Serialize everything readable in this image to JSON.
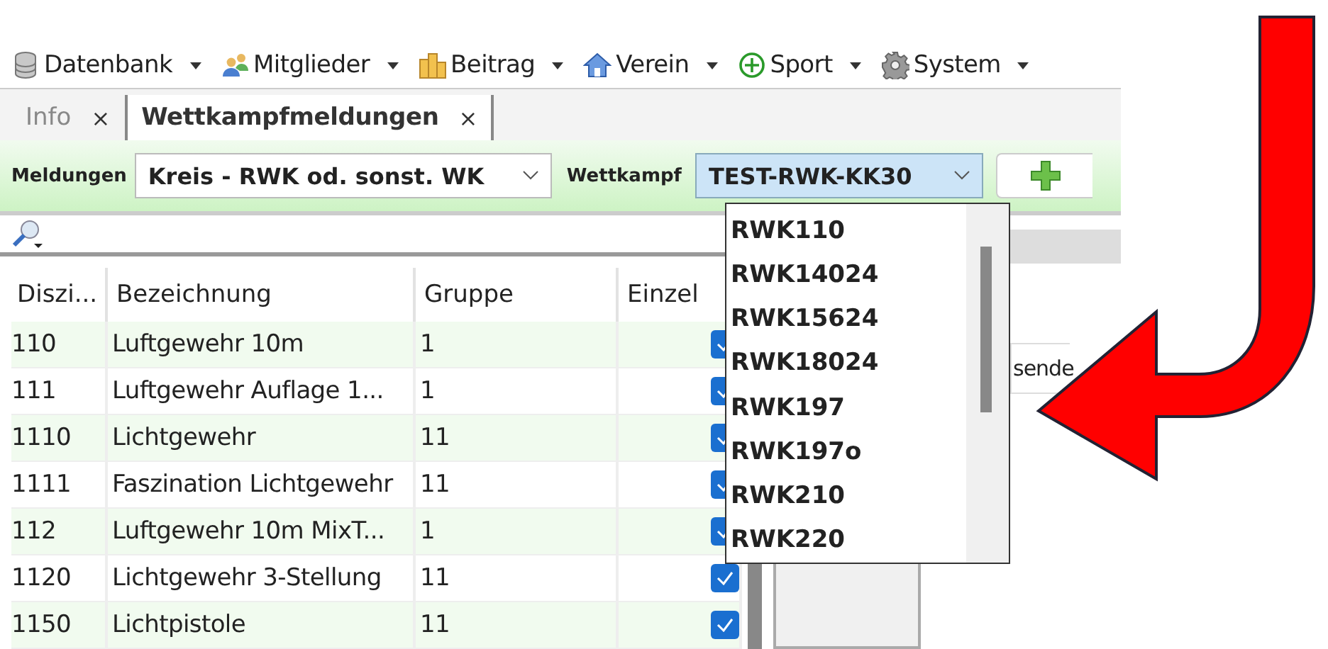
{
  "menu": [
    {
      "kind": "database",
      "label": "Datenbank"
    },
    {
      "kind": "people",
      "label": "Mitglieder"
    },
    {
      "kind": "coins",
      "label": "Beitrag"
    },
    {
      "kind": "home",
      "label": "Verein"
    },
    {
      "kind": "plus",
      "label": "Sport"
    },
    {
      "kind": "gear",
      "label": "System"
    }
  ],
  "tabs": [
    {
      "label": "Info",
      "selected": false,
      "close": "×"
    },
    {
      "label": "Wettkampfmeldungen",
      "selected": true,
      "close": "×"
    }
  ],
  "filter": {
    "meldungen_label": "Meldungen",
    "meldungen_value": "Kreis - RWK od. sonst. WK",
    "wettkampf_label": "Wettkampf",
    "wettkampf_value": "TEST-RWK-KK30",
    "wettkampf_open": true
  },
  "table": {
    "columns": [
      "Diszi...",
      "Bezeichnung",
      "Gruppe",
      "Einzel"
    ],
    "rows": [
      {
        "cells": [
          "110",
          "Luftgewehr 10m",
          "1"
        ],
        "einzel": true
      },
      {
        "cells": [
          "111",
          "Luftgewehr Auflage 1...",
          "1"
        ],
        "einzel": true
      },
      {
        "cells": [
          "1110",
          "Lichtgewehr",
          "11"
        ],
        "einzel": true
      },
      {
        "cells": [
          "1111",
          "Faszination Lichtgewehr",
          "11"
        ],
        "einzel": true
      },
      {
        "cells": [
          "112",
          "Luftgewehr 10m MixT...",
          "1"
        ],
        "einzel": true
      },
      {
        "cells": [
          "1120",
          "Lichtgewehr 3-Stellung",
          "11"
        ],
        "einzel": true
      },
      {
        "cells": [
          "1150",
          "Lichtpistole",
          "11"
        ],
        "einzel": true
      }
    ]
  },
  "side_field": {
    "value": "sende"
  },
  "dropdown": {
    "options": [
      "RWK110",
      "RWK14024",
      "RWK15624",
      "RWK18024",
      "RWK197",
      "RWK197o",
      "RWK210",
      "RWK220"
    ]
  }
}
